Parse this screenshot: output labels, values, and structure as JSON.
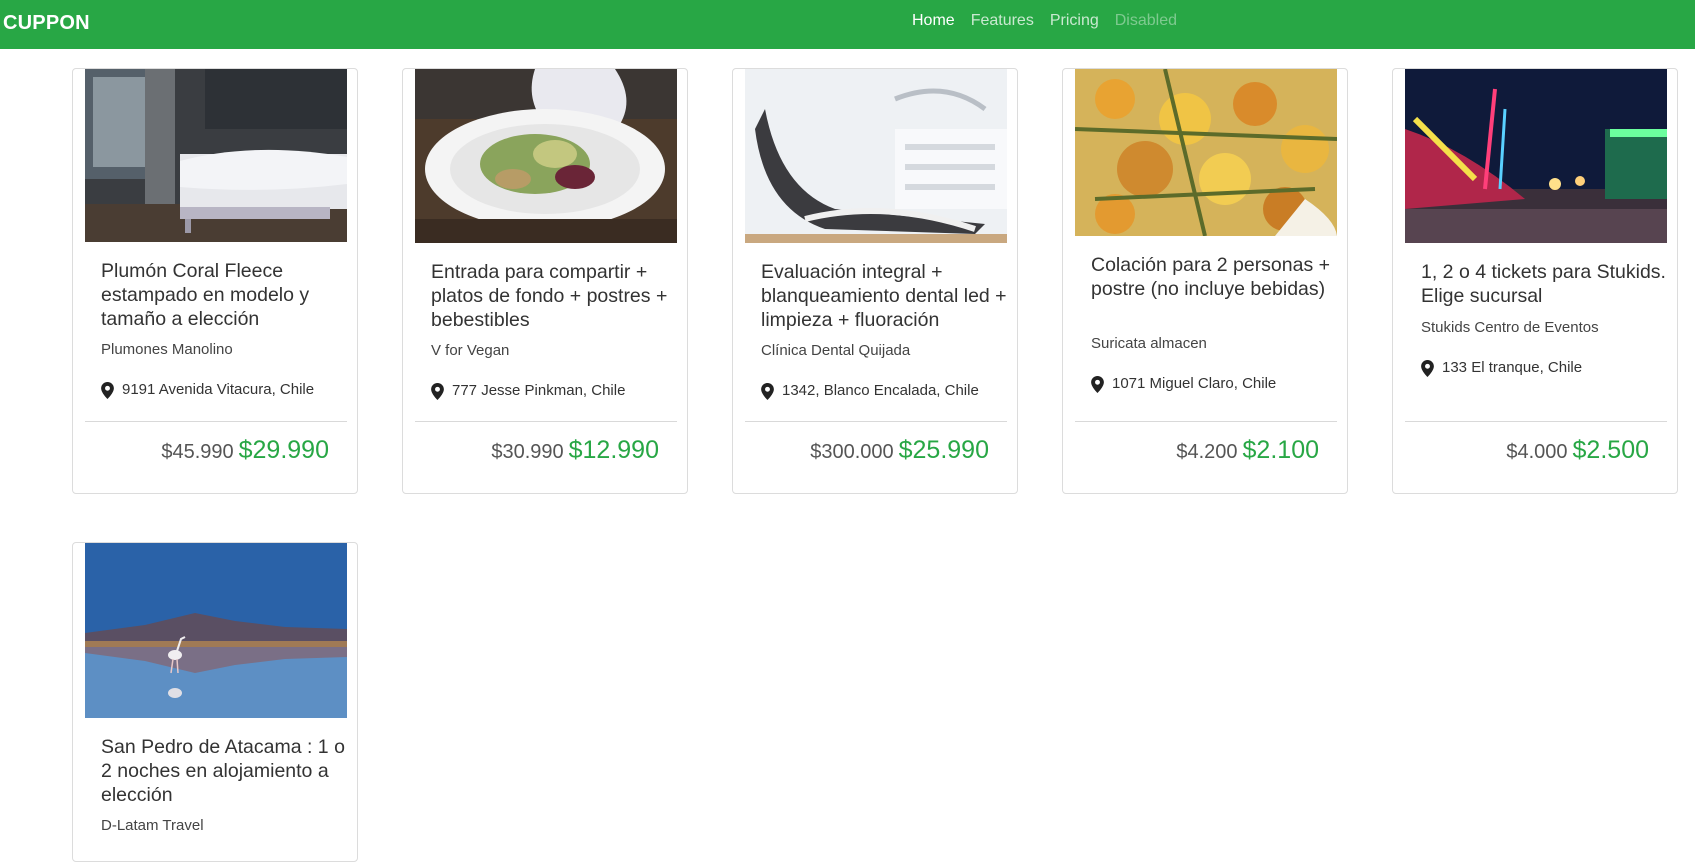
{
  "navbar": {
    "brand": "CUPPON",
    "links": [
      {
        "label": "Home",
        "state": "active"
      },
      {
        "label": "Features",
        "state": "normal"
      },
      {
        "label": "Pricing",
        "state": "normal"
      },
      {
        "label": "Disabled",
        "state": "disabled"
      }
    ]
  },
  "colors": {
    "brand_green": "#28a745",
    "price_green": "#28a745",
    "text": "#333333"
  },
  "deals": [
    {
      "image_icon": "bedroom-photo",
      "title": "Plumón Coral Fleece estampado en modelo y tamaño a elección",
      "merchant": "Plumones Manolino",
      "address": "9191 Avenida Vitacura, Chile",
      "old_price": "$45.990",
      "new_price": "$29.990"
    },
    {
      "image_icon": "salad-plate-photo",
      "title": "Entrada para compartir + platos de fondo + postres + bebestibles",
      "merchant": "V for Vegan",
      "address": "777 Jesse Pinkman, Chile",
      "old_price": "$30.990",
      "new_price": "$12.990"
    },
    {
      "image_icon": "dental-chair-photo",
      "title": "Evaluación integral + blanqueamiento dental led + limpieza + fluoración",
      "merchant": "Clínica Dental Quijada",
      "address": "1342, Blanco Encalada, Chile",
      "old_price": "$300.000",
      "new_price": "$25.990"
    },
    {
      "image_icon": "stew-dish-photo",
      "title": "Colación para 2 personas + postre (no incluye bebidas)",
      "merchant": "Suricata almacen",
      "address": "1071 Miguel Claro, Chile",
      "old_price": "$4.200",
      "new_price": "$2.100"
    },
    {
      "image_icon": "fairground-photo",
      "title": "1, 2 o 4 tickets para Stukids. Elige sucursal",
      "merchant": "Stukids Centro de Eventos",
      "address": "133 El tranque, Chile",
      "old_price": "$4.000",
      "new_price": "$2.500"
    },
    {
      "image_icon": "salt-flat-flamingo-photo",
      "title": "San Pedro de Atacama : 1 o 2 noches en alojamiento a elección",
      "merchant": "D-Latam Travel"
    }
  ]
}
